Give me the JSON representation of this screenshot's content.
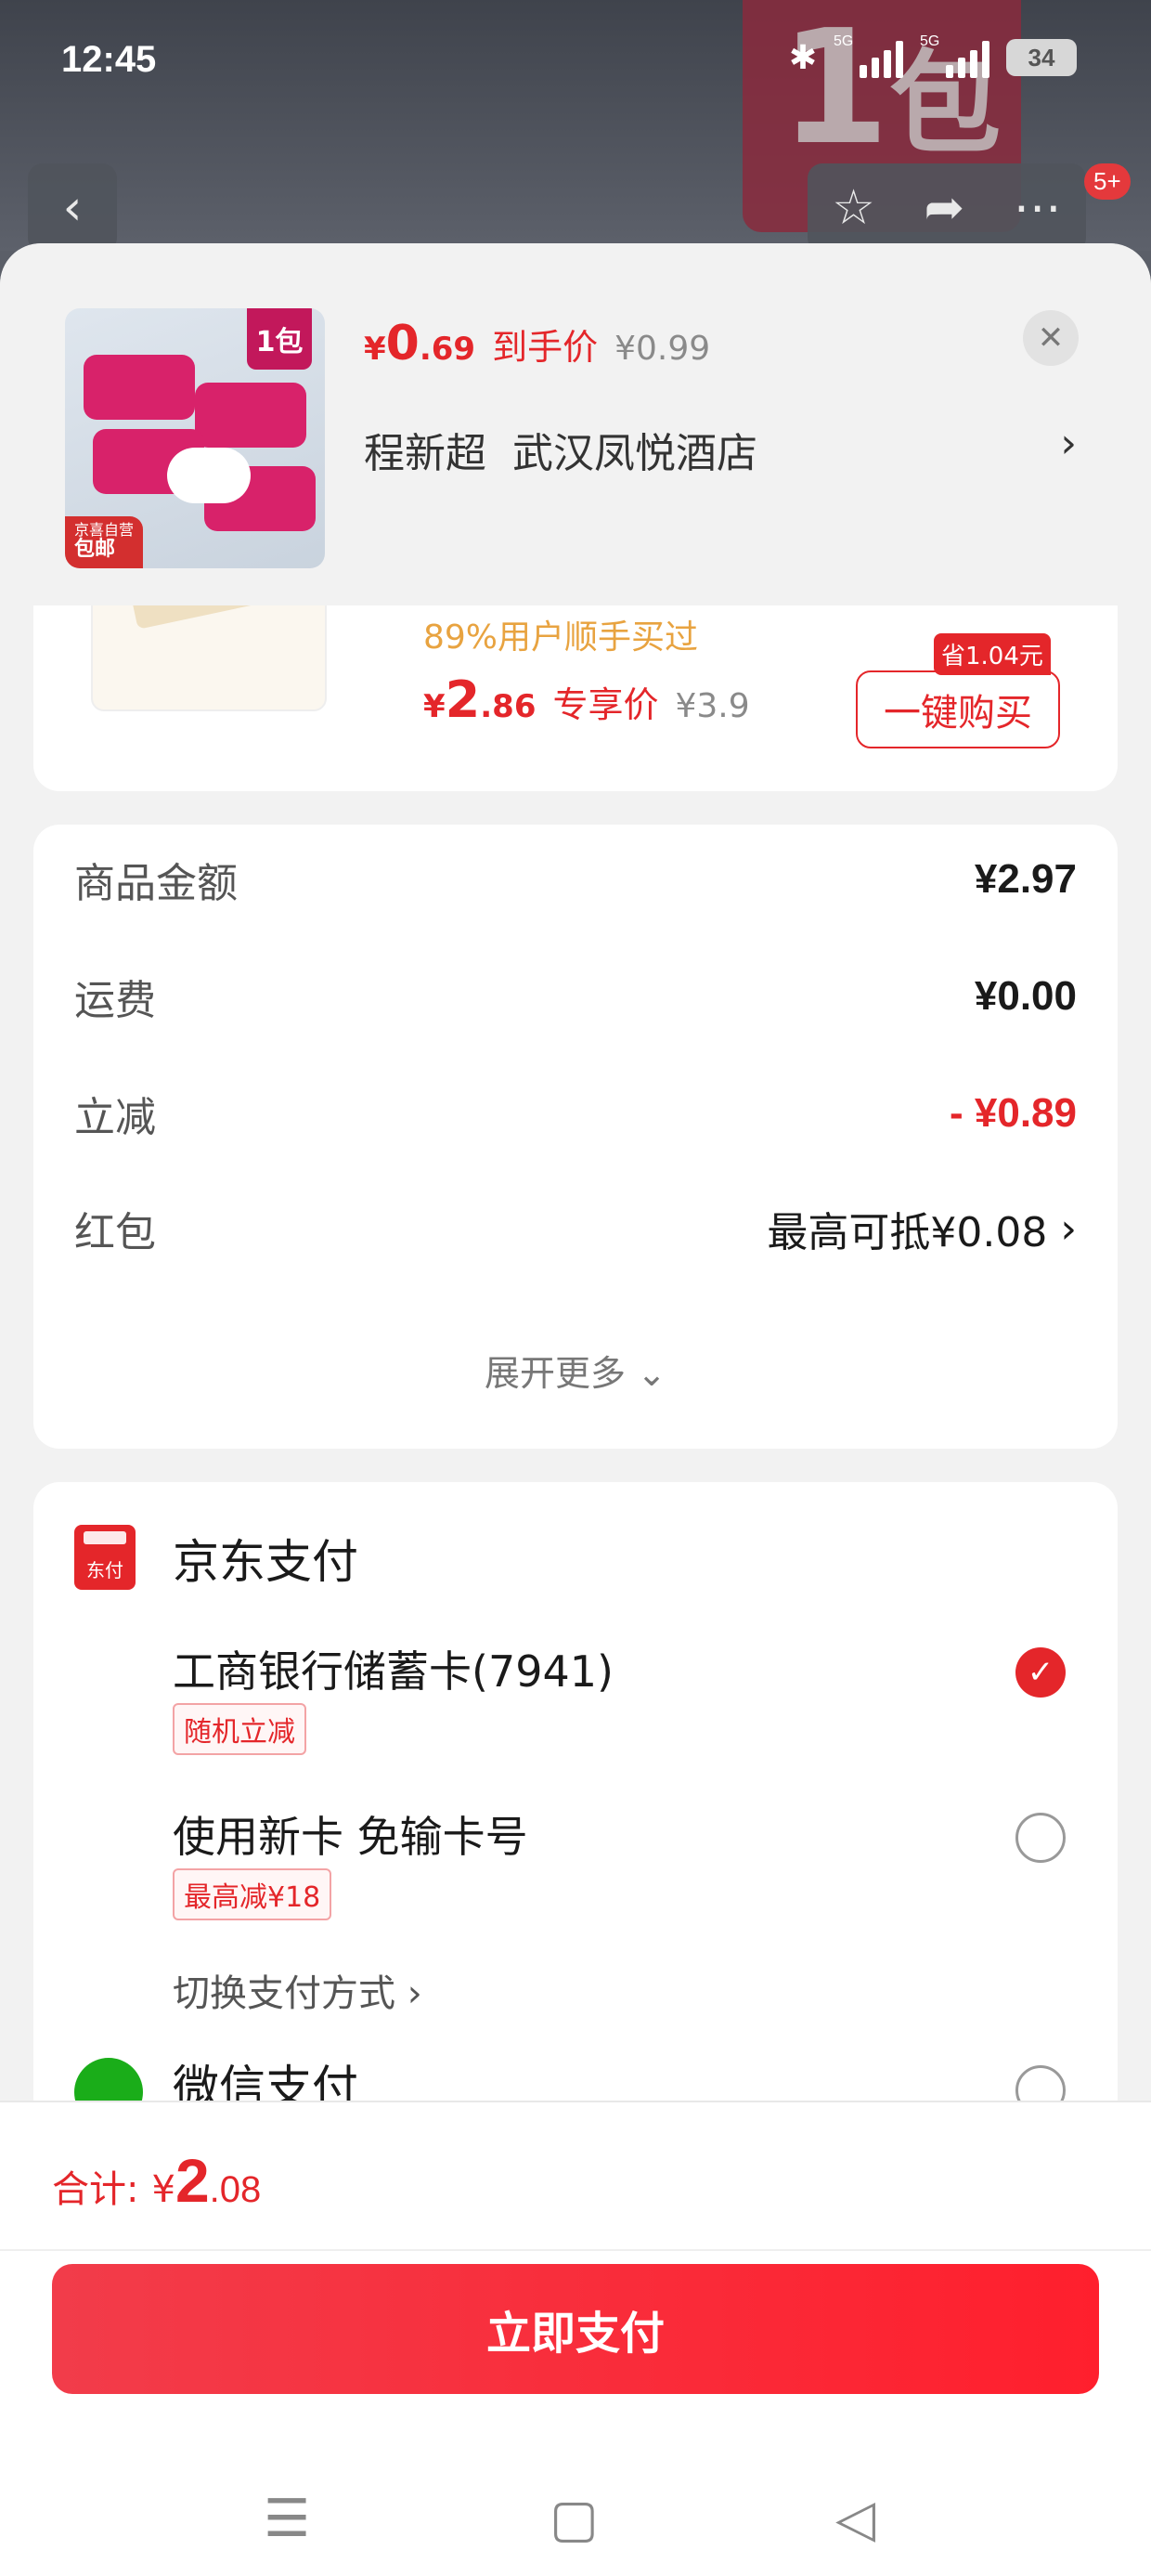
{
  "status": {
    "time": "12:45",
    "signal_tag_1": "5G",
    "signal_tag_2": "5G",
    "battery": "34",
    "notif_badge": "5+"
  },
  "backdrop": {
    "banner_text": "1",
    "banner_text_small": "包"
  },
  "product": {
    "thumb_badge": "1包",
    "thumb_tag_top": "京喜自营",
    "thumb_tag": "包邮",
    "price_symbol": "¥",
    "price_int": "0",
    "price_dec": ".69",
    "price_label": "到手价",
    "orig_price": "¥0.99",
    "buyer_name": "程新超",
    "address": "武汉凤悦酒店",
    "close_icon": "close-icon"
  },
  "recommend": {
    "promo": "89%用户顺手买过",
    "price_symbol": "¥",
    "price_int": "2",
    "price_dec": ".86",
    "price_label": "专享价",
    "orig_price": "¥3.9",
    "save_tag": "省1.04元",
    "buy_label": "一键购买"
  },
  "amounts": {
    "rows": [
      {
        "label": "商品金额",
        "value": "¥2.97"
      },
      {
        "label": "运费",
        "value": "¥0.00"
      },
      {
        "label": "立减",
        "value": "- ¥0.89"
      },
      {
        "label": "红包",
        "value": "最高可抵¥0.08"
      }
    ],
    "more": "展开更多"
  },
  "payment": {
    "jd_icon_text": "东付",
    "jd_title": "京东支付",
    "options": [
      {
        "name": "工商银行储蓄卡(7941)",
        "tag": "随机立减",
        "selected": true
      },
      {
        "name": "使用新卡 免输卡号",
        "tag": "最高减¥18",
        "selected": false
      }
    ],
    "switch": "切换支付方式",
    "wechat": "微信支付"
  },
  "footer": {
    "total_label": "合计:",
    "total_symbol": "¥",
    "total_int": "2",
    "total_dec": ".08",
    "pay_button": "立即支付"
  },
  "colors": {
    "accent": "#e4262a",
    "promo": "#e8a340",
    "wechat": "#1aad19"
  }
}
